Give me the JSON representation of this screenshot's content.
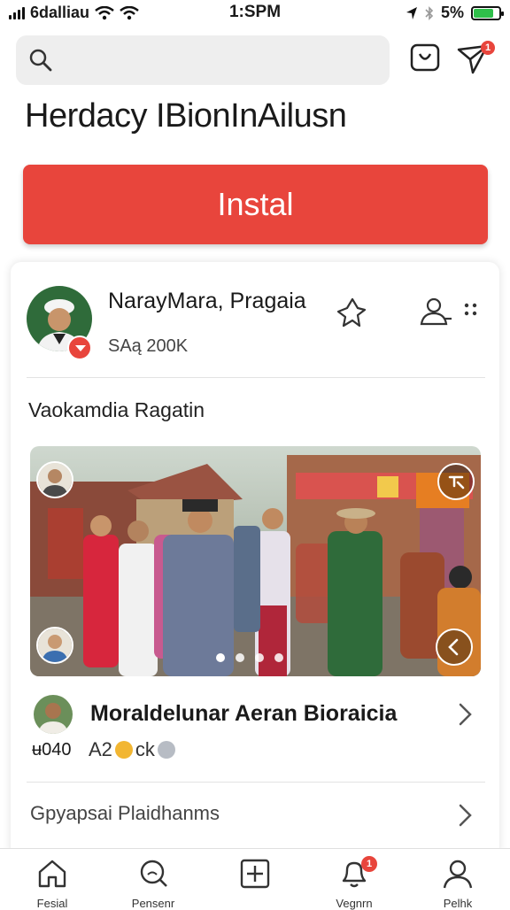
{
  "status_bar": {
    "carrier": "6dalliau",
    "time": "1:SPM",
    "battery_percent": "5%",
    "battery_level": 0.85
  },
  "search": {
    "value": "",
    "placeholder": ""
  },
  "header": {
    "notification_count": "1"
  },
  "page_title": "Herdacy IBionInAilusn",
  "install_label": "Instal",
  "author": {
    "name": "NarayMara, Pragaia",
    "meta": "SAą 200K"
  },
  "post": {
    "caption": "Vaokamdia Ragatin",
    "carousel_slides": 4,
    "carousel_active": 1
  },
  "comment": {
    "title": "Moraldelunar Aeran Bioraicia",
    "count": "ʉ040",
    "meta_prefix": "A2",
    "meta_suffix": "ck"
  },
  "related_link": "Gpyapsai Plaidhanms",
  "tab_bar": {
    "items": [
      {
        "label": "Fesial"
      },
      {
        "label": "Pensenr"
      },
      {
        "label": ""
      },
      {
        "label": "Vegnrn",
        "badge": "1"
      },
      {
        "label": "Pelhk"
      }
    ]
  },
  "colors": {
    "accent": "#e8453c",
    "battery": "#2fbf4a",
    "search_bg": "#eeeeee"
  }
}
